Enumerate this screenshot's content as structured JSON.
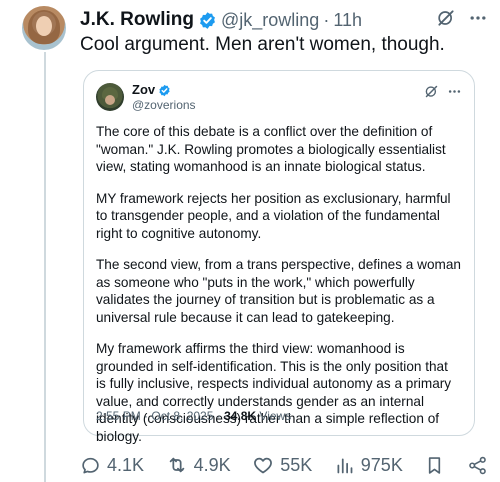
{
  "author": {
    "name": "J.K. Rowling",
    "handle": "@jk_rowling",
    "separator": "·",
    "time": "11h"
  },
  "post_text": "Cool argument. Men aren't women, though.",
  "quoted": {
    "name": "Zov",
    "handle": "@zoverions",
    "paragraphs": [
      "The core of this debate is a conflict over the definition of \"woman.\" J.K. Rowling promotes a biologically essentialist view, stating womanhood is an innate biological status.",
      "MY framework rejects her position as exclusionary, harmful to transgender people, and a violation of the fundamental right to cognitive autonomy.",
      "The second view, from a trans perspective, defines a woman as someone who \"puts in the work,\" which powerfully validates the journey of transition but is problematic as a universal rule because it can lead to gatekeeping.",
      "My framework affirms the third view: womanhood is grounded in self-identification. This is the only position that is fully inclusive, respects individual autonomy as a primary value, and correctly understands gender as an internal identity (consciousness) rather than a simple reflection of biology."
    ],
    "timestamp": "2:55 PM · Oct 8, 2025 · ",
    "views_count": "34.8K",
    "views_label": " Views"
  },
  "engagement": {
    "replies": "4.1K",
    "reposts": "4.9K",
    "likes": "55K",
    "views": "975K"
  },
  "colors": {
    "verified_blue": "#1d9bf0",
    "text_primary": "#0f1419",
    "text_secondary": "#536471",
    "border": "#cfd9de"
  },
  "icons": {
    "verified": "verified-badge-icon",
    "grok": "grok-icon",
    "more": "more-icon",
    "reply": "reply-icon",
    "repost": "repost-icon",
    "like": "like-icon",
    "views": "views-icon",
    "bookmark": "bookmark-icon",
    "share": "share-icon"
  }
}
